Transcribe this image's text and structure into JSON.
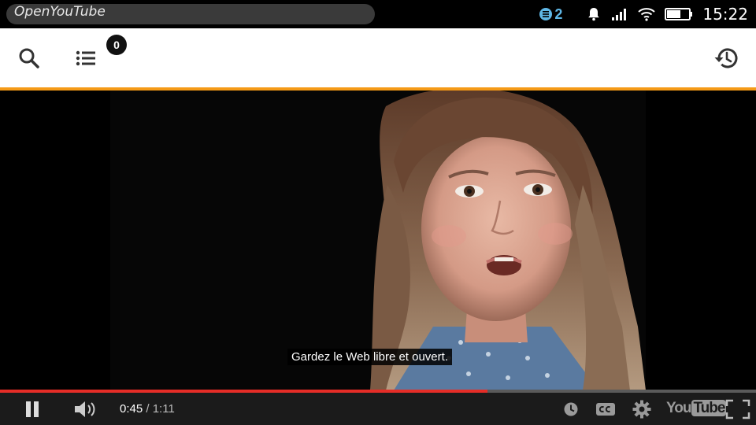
{
  "statusbar": {
    "app_title": "OpenYouTube",
    "notification_count": "2",
    "time": "15:22"
  },
  "toolbar": {
    "playlist_count": "0",
    "accent_color": "#f59a17"
  },
  "video": {
    "subtitle": "Gardez le Web libre et ouvert.",
    "current_time": "0:45",
    "separator": "/",
    "duration": "1:11",
    "progress_fraction": 0.645,
    "logo_you": "You",
    "logo_tube": "Tube"
  },
  "icons": {
    "search": "search-icon",
    "playlist": "list-icon",
    "history": "history-icon",
    "pause": "pause-icon",
    "volume": "volume-icon",
    "watch_later": "clock-icon",
    "captions": "cc-icon",
    "settings": "gear-icon",
    "fullscreen": "fullscreen-icon"
  }
}
